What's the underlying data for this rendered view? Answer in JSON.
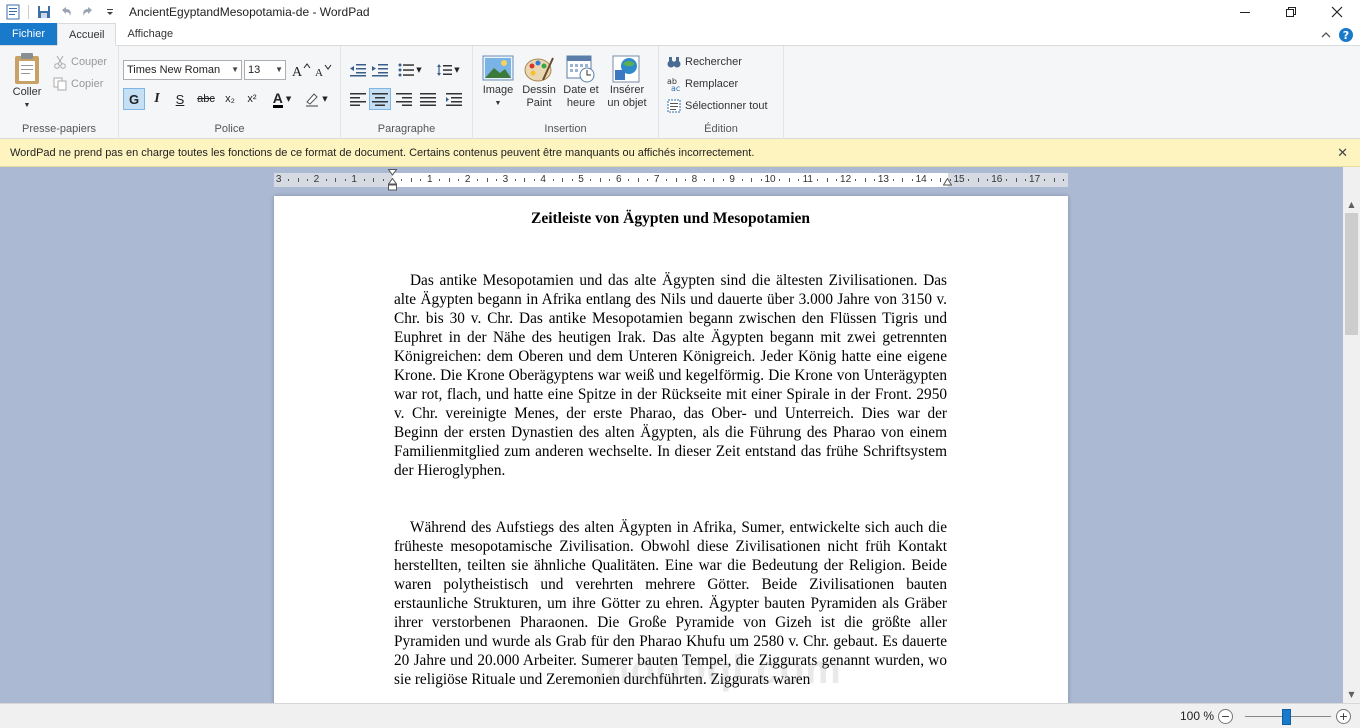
{
  "window": {
    "title": "AncientEgyptandMesopotamia-de - WordPad"
  },
  "tabs": {
    "file": "Fichier",
    "home": "Accueil",
    "view": "Affichage"
  },
  "ribbon": {
    "clipboard": {
      "label": "Presse-papiers",
      "paste": "Coller",
      "cut": "Couper",
      "copy": "Copier"
    },
    "font": {
      "label": "Police",
      "family": "Times New Roman",
      "size": "13",
      "bold": "G",
      "italic": "I",
      "underline": "S",
      "strike": "abc",
      "subscript": "x₂",
      "superscript": "x²",
      "color_glyph": "A"
    },
    "paragraph": {
      "label": "Paragraphe"
    },
    "insert": {
      "label": "Insertion",
      "image": "Image",
      "paint_line1": "Dessin",
      "paint_line2": "Paint",
      "date_line1": "Date et",
      "date_line2": "heure",
      "object_line1": "Insérer",
      "object_line2": "un objet"
    },
    "editing": {
      "label": "Édition",
      "find": "Rechercher",
      "replace": "Remplacer",
      "select_all": "Sélectionner tout"
    }
  },
  "infobar": {
    "message": "WordPad ne prend pas en charge toutes les fonctions de ce format de document. Certains contenus peuvent être manquants ou affichés incorrectement."
  },
  "ruler": {
    "labels": [
      "3",
      "2",
      "1",
      "1",
      "2",
      "3",
      "4",
      "5",
      "6",
      "7",
      "8",
      "9",
      "10",
      "11",
      "12",
      "13",
      "14",
      "15",
      "16",
      "17"
    ]
  },
  "document": {
    "title": "Zeitleiste von Ägypten und  Mesopotamien",
    "paragraph1": "Das antike Mesopotamien und das alte Ägypten sind die ältesten Zivilisationen. Das alte Ägypten begann in Afrika entlang des Nils und dauerte über 3.000 Jahre von 3150 v. Chr. bis 30 v. Chr. Das antike Mesopotamien begann zwischen den Flüssen Tigris und Euphret in der Nähe des heutigen Irak. Das alte Ägypten begann mit zwei getrennten Königreichen: dem Oberen und dem Unteren Königreich. Jeder König hatte eine eigene Krone. Die Krone Oberägyptens war weiß und kegelförmig. Die Krone von Unterägypten war rot, flach, und hatte eine Spitze in der Rückseite mit einer Spirale in der Front. 2950 v. Chr. vereinigte Menes, der erste Pharao, das Ober- und Unterreich. Dies war der Beginn der ersten Dynastien des alten Ägypten, als die Führung des Pharao von einem Familienmitglied zum anderen wechselte. In dieser Zeit entstand das frühe Schriftsystem der Hieroglyphen.",
    "paragraph2": "Während des Aufstiegs des alten Ägypten in Afrika, Sumer, entwickelte sich auch die früheste mesopotamische Zivilisation. Obwohl diese Zivilisationen nicht früh Kontakt herstellten, teilten sie ähnliche Qualitäten. Eine war die Bedeutung der Religion. Beide waren polytheistisch und verehrten mehrere Götter. Beide Zivilisationen bauten erstaunliche Strukturen, um ihre Götter zu ehren. Ägypter bauten Pyramiden als Gräber ihrer verstorbenen Pharaonen. Die Große Pyramide von Gizeh ist die größte aller Pyramiden und wurde als Grab für den Pharao Khufu um 2580 v. Chr. gebaut. Es dauerte 20 Jahre und 20.000 Arbeiter. Sumerer bauten Tempel, die Ziggurats genannt wurden, wo sie religiöse Rituale und Zeremonien durchführten. Ziggurats waren",
    "watermark": "moobql.com"
  },
  "statusbar": {
    "zoom": "100 %",
    "zoom_out": "−",
    "zoom_in": "+"
  }
}
